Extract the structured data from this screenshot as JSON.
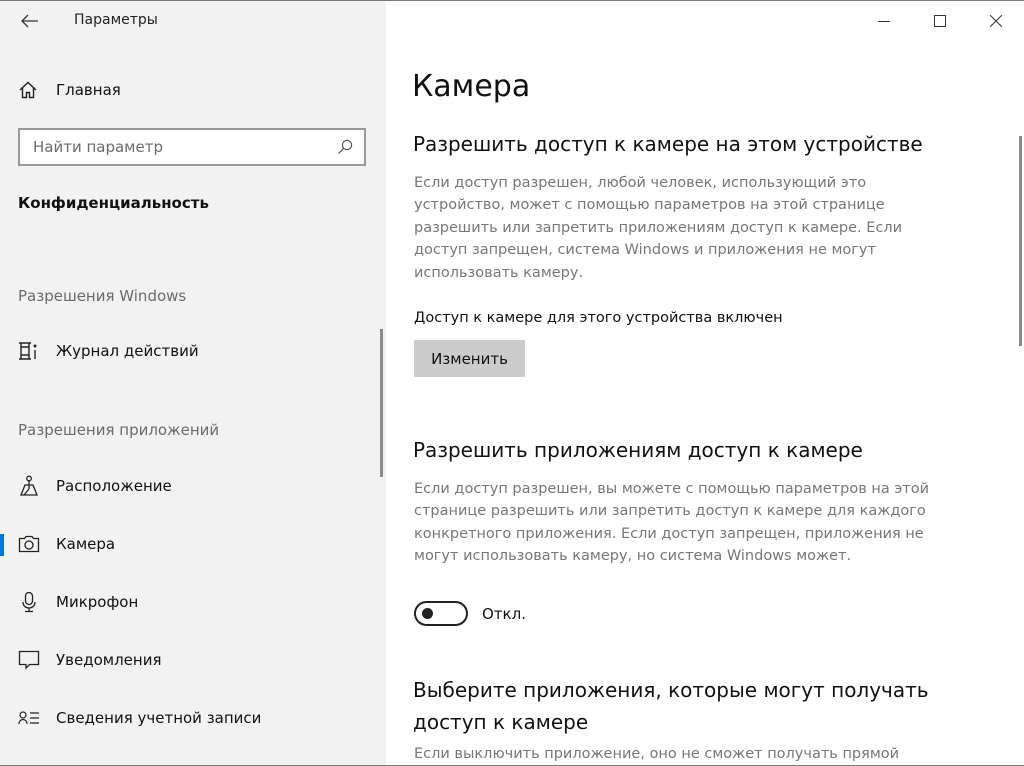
{
  "window": {
    "title": "Параметры",
    "controls": {
      "minimize_icon": "minimize-icon",
      "maximize_icon": "maximize-icon",
      "close_icon": "close-icon"
    }
  },
  "sidebar": {
    "back_icon": "back-arrow-icon",
    "home": {
      "label": "Главная",
      "icon": "home-icon"
    },
    "search": {
      "placeholder": "Найти параметр",
      "value": "",
      "icon": "search-icon"
    },
    "section_title": "Конфиденциальность",
    "groups": [
      {
        "label": "Разрешения Windows",
        "items": [
          {
            "label": "Журнал действий",
            "icon": "activity-history-icon",
            "selected": false
          }
        ]
      },
      {
        "label": "Разрешения приложений",
        "items": [
          {
            "label": "Расположение",
            "icon": "location-icon",
            "selected": false
          },
          {
            "label": "Камера",
            "icon": "camera-icon",
            "selected": true
          },
          {
            "label": "Микрофон",
            "icon": "microphone-icon",
            "selected": false
          },
          {
            "label": "Уведомления",
            "icon": "notifications-icon",
            "selected": false
          },
          {
            "label": "Сведения учетной записи",
            "icon": "account-info-icon",
            "selected": false
          }
        ]
      }
    ]
  },
  "main": {
    "page_title": "Камера",
    "device_section": {
      "heading": "Разрешить доступ к камере на этом устройстве",
      "description": "Если доступ разрешен, любой человек, использующий это устройство, может с помощью параметров на этой странице разрешить или запретить приложениям доступ к камере. Если доступ запрещен, система Windows и приложения не могут использовать камеру.",
      "status": "Доступ к камере для этого устройства включен",
      "button_label": "Изменить"
    },
    "apps_section": {
      "heading": "Разрешить приложениям доступ к камере",
      "description": "Если доступ разрешен, вы можете с помощью параметров на этой странице разрешить или запретить доступ к камере для каждого конкретного приложения. Если доступ запрещен, приложения не могут использовать камеру, но система Windows может.",
      "toggle_state": "off",
      "toggle_label": "Откл."
    },
    "choose_section": {
      "heading": "Выберите приложения, которые могут получать доступ к камере",
      "description": "Если выключить приложение, оно не сможет получать прямой"
    }
  },
  "colors": {
    "accent": "#0078d7",
    "sidebar_bg": "#f2f2f2",
    "button_bg": "#cccccc",
    "secondary_text": "#777777"
  }
}
